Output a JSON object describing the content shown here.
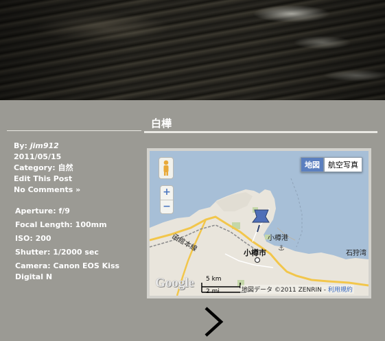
{
  "post": {
    "title": "白樺",
    "by_label": "By:",
    "author": "jim912",
    "date": "2011/05/15",
    "category_label": "Category:",
    "category": "自然",
    "edit_link": "Edit This Post",
    "comments_link": "No Comments »"
  },
  "exif": {
    "aperture": "Aperture:  f/9",
    "focal_length": "Focal Length:  100mm",
    "iso": "ISO:  200",
    "shutter": "Shutter:  1/2000 sec",
    "camera": "Camera:  Canon EOS Kiss Digital N"
  },
  "map": {
    "type_map": "地図",
    "type_satellite": "航空写真",
    "zoom_in": "+",
    "zoom_out": "−",
    "logo": "Google",
    "scale_km": "5 km",
    "scale_mi": "2 mi",
    "attribution": "地図データ ©2011 ZENRIN -",
    "terms": "利用規約",
    "labels": {
      "city": "小樽市",
      "port": "小樽港",
      "right": "石狩湾",
      "railway": "函館本線"
    },
    "colors": {
      "sea": "#a7bfd7",
      "land": "#e9e5dc",
      "road": "#f2c64b",
      "park": "#c4d7a8"
    }
  },
  "nav": {
    "next_icon": "chevron-right-icon"
  }
}
